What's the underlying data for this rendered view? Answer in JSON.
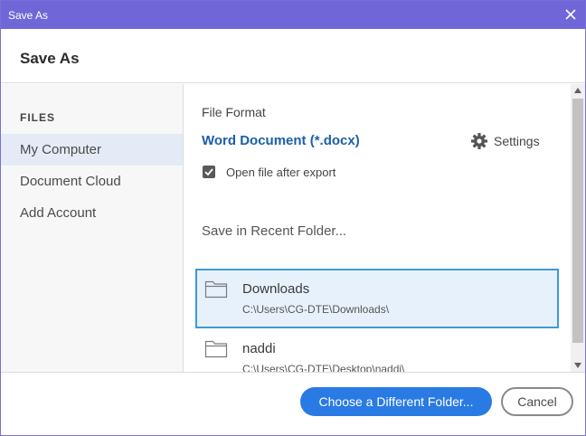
{
  "window": {
    "title": "Save As"
  },
  "header": {
    "title": "Save As"
  },
  "sidebar": {
    "section_label": "FILES",
    "items": [
      {
        "label": "My Computer",
        "active": true
      },
      {
        "label": "Document Cloud",
        "active": false
      },
      {
        "label": "Add Account",
        "active": false
      }
    ]
  },
  "main": {
    "format_label": "File Format",
    "format_value": "Word Document (*.docx)",
    "settings_label": "Settings",
    "open_after_export": {
      "label": "Open file after export",
      "checked": true
    },
    "recent_label": "Save in Recent Folder...",
    "folders": [
      {
        "name": "Downloads",
        "path": "C:\\Users\\CG-DTE\\Downloads\\",
        "selected": true
      },
      {
        "name": "naddi",
        "path": "C:\\Users\\CG-DTE\\Desktop\\naddi\\",
        "selected": false
      }
    ]
  },
  "footer": {
    "choose_label": "Choose a Different Folder...",
    "cancel_label": "Cancel"
  },
  "colors": {
    "titlebar": "#6f67d8",
    "accent_blue": "#2a7ae4",
    "link_blue": "#1a5fa8",
    "selected_row_border": "#3f9ad6",
    "selected_row_bg": "#e7f1fb"
  },
  "icons": {
    "close": "close-icon",
    "settings": "gear-icon",
    "checkbox": "checkmark-icon",
    "folder": "folder-icon"
  }
}
